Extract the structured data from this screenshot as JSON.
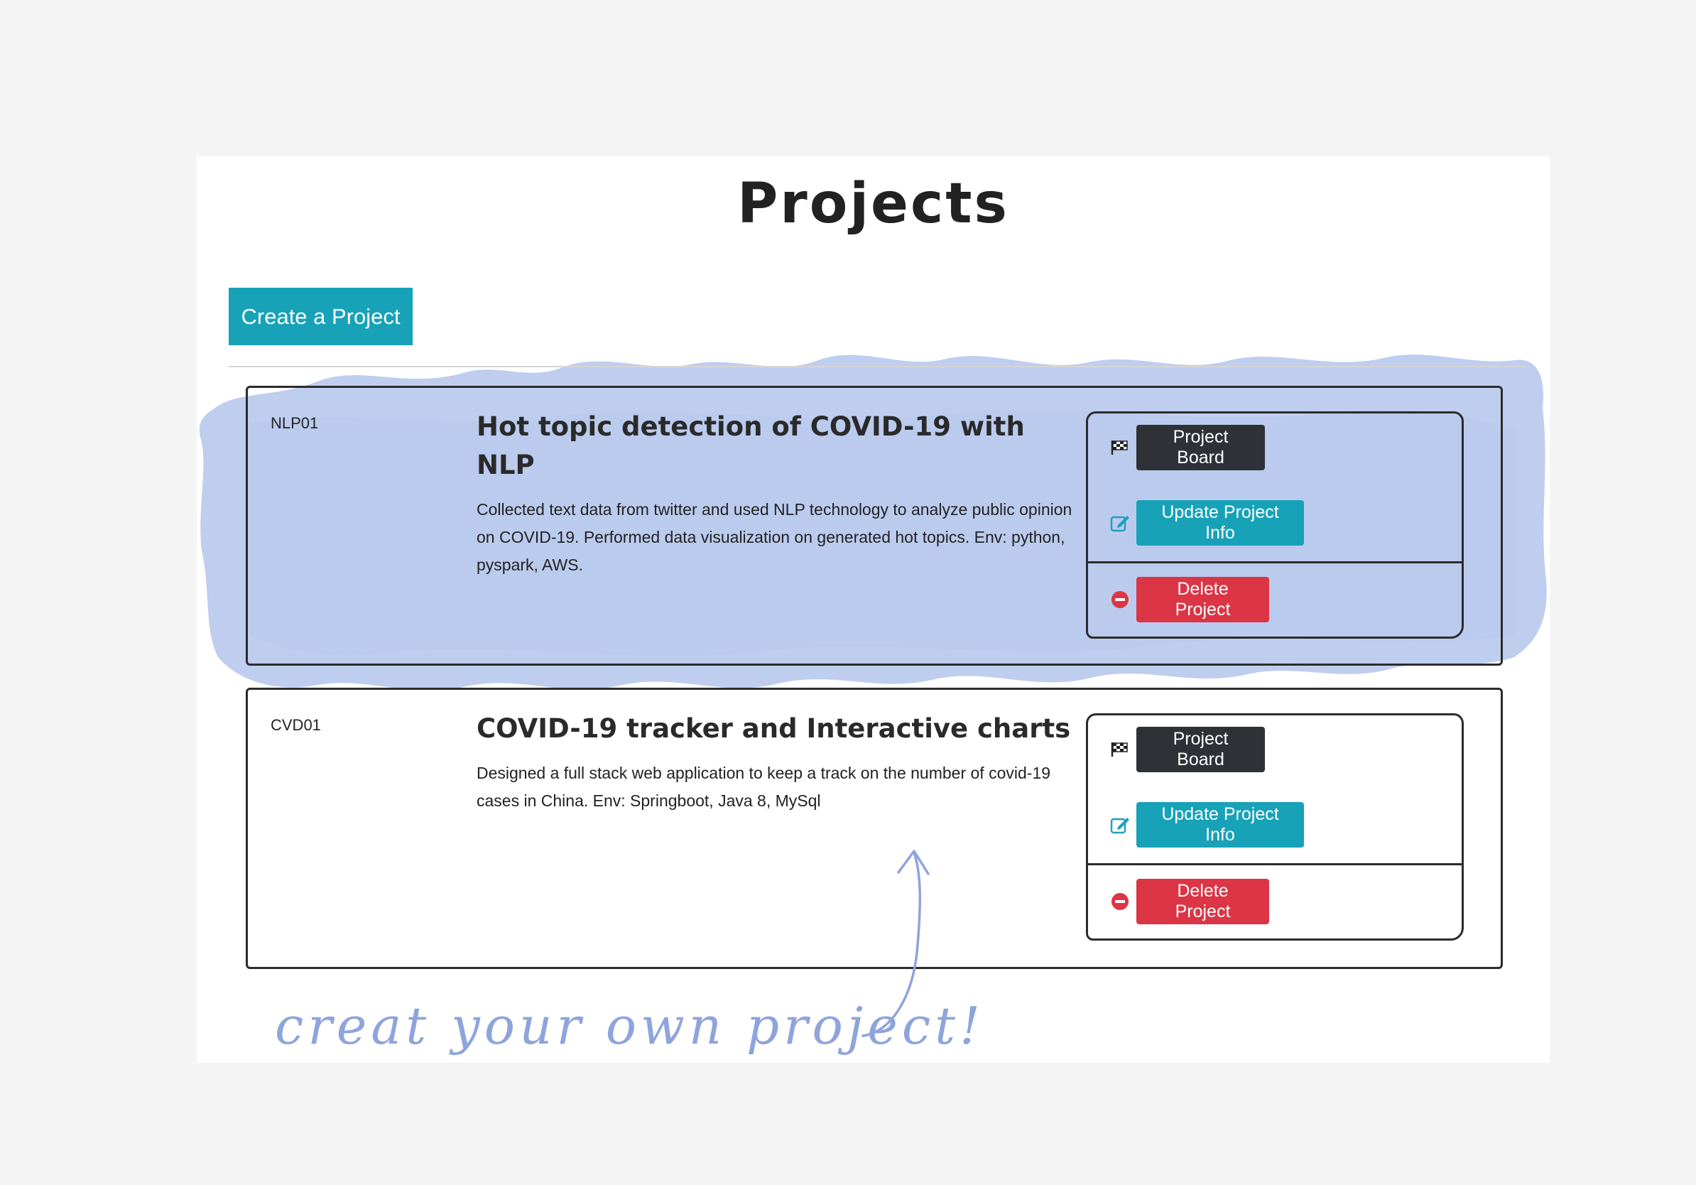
{
  "page": {
    "title": "Projects",
    "create_button_label": "Create a Project"
  },
  "projects": [
    {
      "id": "NLP01",
      "title": "Hot topic detection of COVID-19 with NLP",
      "description": "Collected text data from twitter and used NLP technology to analyze public opinion on COVID-19. Performed data visualization on generated hot topics. Env: python, pyspark, AWS.",
      "actions": {
        "board_label": "Project Board",
        "update_label": "Update Project Info",
        "delete_label": "Delete Project"
      }
    },
    {
      "id": "CVD01",
      "title": "COVID-19 tracker and Interactive charts",
      "description": "Designed a full stack web application to keep a track on the number of covid-19 cases in China. Env: Springboot, Java 8, MySql",
      "actions": {
        "board_label": "Project Board",
        "update_label": "Update Project Info",
        "delete_label": "Delete Project"
      }
    }
  ],
  "annotation": {
    "handwritten_note": "creat your own project!"
  },
  "icons": {
    "board": "checkered-flag-icon",
    "update": "edit-pencil-icon",
    "delete": "minus-circle-icon"
  },
  "colors": {
    "primary": "#17a2b8",
    "dark": "#2e3136",
    "danger": "#dc3545",
    "highlight_wash": "#a9bde8",
    "handwriting": "#8ea4dc"
  }
}
